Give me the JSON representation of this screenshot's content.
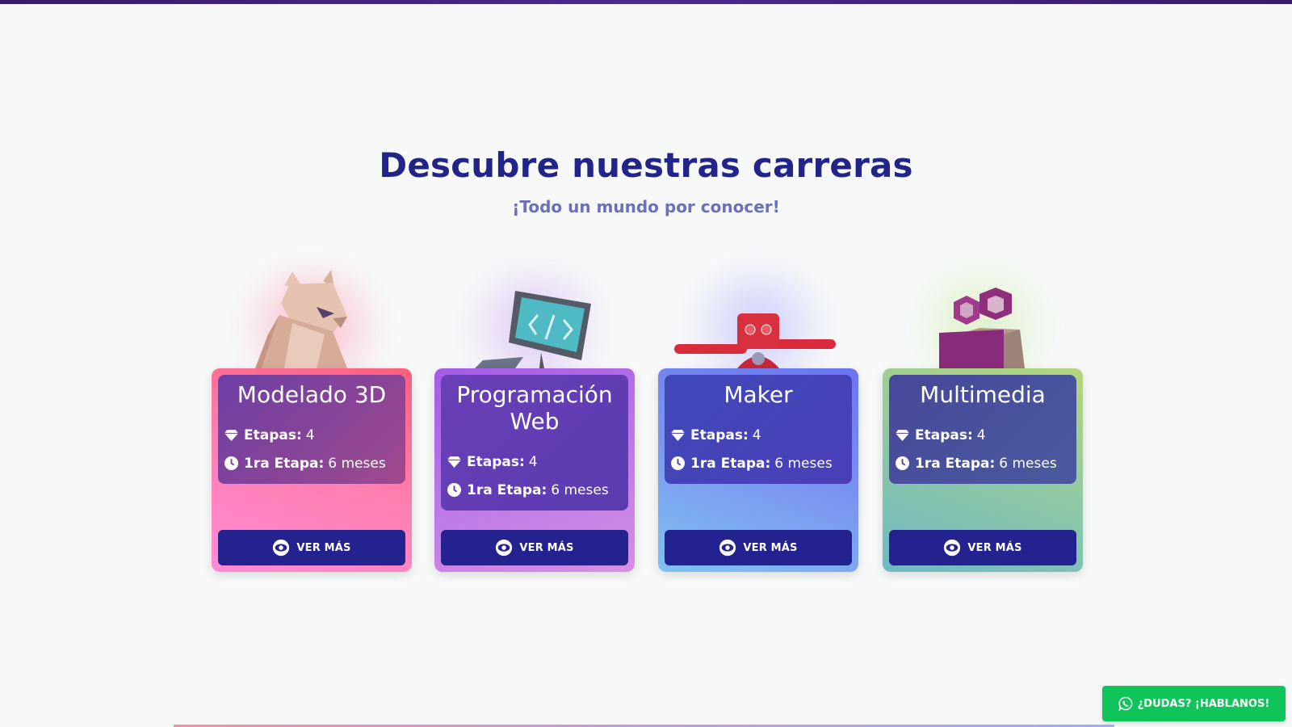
{
  "section": {
    "title": "Descubre nuestras carreras",
    "subtitle": "¡Todo un mundo por conocer!"
  },
  "cards": [
    {
      "title": "Modelado 3D",
      "stages_label": "Etapas:",
      "stages_value": "4",
      "first_stage_label": "1ra Etapa:",
      "first_stage_value": "6 meses",
      "button_label": "VER MÁS",
      "illustration": "low-poly-fox"
    },
    {
      "title": "Programación Web",
      "stages_label": "Etapas:",
      "stages_value": "4",
      "first_stage_label": "1ra Etapa:",
      "first_stage_value": "6 meses",
      "button_label": "VER MÁS",
      "illustration": "code-monitor"
    },
    {
      "title": "Maker",
      "stages_label": "Etapas:",
      "stages_value": "4",
      "first_stage_label": "1ra Etapa:",
      "first_stage_value": "6 meses",
      "button_label": "VER MÁS",
      "illustration": "red-robot"
    },
    {
      "title": "Multimedia",
      "stages_label": "Etapas:",
      "stages_value": "4",
      "first_stage_label": "1ra Etapa:",
      "first_stage_value": "6 meses",
      "button_label": "VER MÁS",
      "illustration": "film-camera"
    }
  ],
  "whatsapp": {
    "label": "¿DUDAS? ¡HABLANOS!",
    "icon": "whatsapp-icon",
    "color": "#0fc55a"
  },
  "icons": {
    "stages": "diamond-icon",
    "duration": "clock-icon",
    "button": "eye-icon"
  },
  "colors": {
    "heading": "#22248a",
    "subheading": "#6b70b8",
    "button": "#24228e"
  }
}
